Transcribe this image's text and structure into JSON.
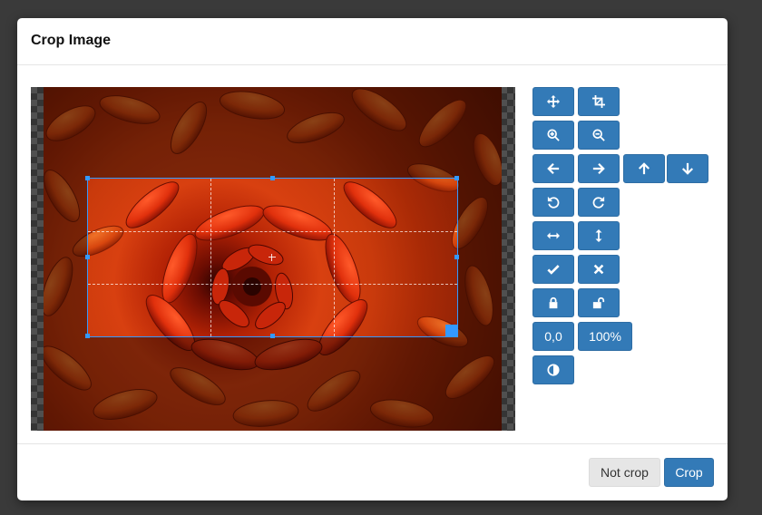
{
  "modal": {
    "title": "Crop Image"
  },
  "toolbar": {
    "move": "move-icon",
    "crop": "crop-icon",
    "zoom_in": "zoom-in-icon",
    "zoom_out": "zoom-out-icon",
    "move_left": "arrow-left-icon",
    "move_right": "arrow-right-icon",
    "move_up": "arrow-up-icon",
    "move_down": "arrow-down-icon",
    "rotate_left": "rotate-left-icon",
    "rotate_right": "rotate-right-icon",
    "flip_horizontal": "flip-horizontal-icon",
    "flip_vertical": "flip-vertical-icon",
    "apply": "check-icon",
    "clear": "cross-icon",
    "lock": "lock-icon",
    "unlock": "unlock-icon",
    "reset_position_label": "0,0",
    "zoom_100_label": "100%",
    "contrast": "contrast-icon"
  },
  "footer": {
    "not_crop_label": "Not crop",
    "crop_label": "Crop"
  },
  "colors": {
    "primary": "#337ab7",
    "crop_outline": "#3399ff",
    "backdrop": "#3a3a3a"
  }
}
